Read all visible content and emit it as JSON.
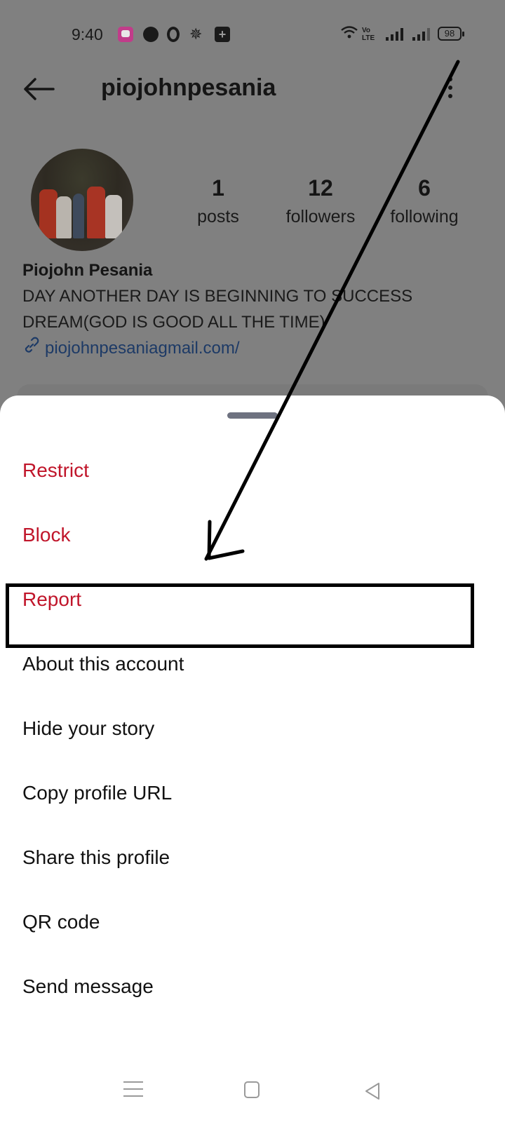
{
  "status_bar": {
    "time": "9:40",
    "notification_icons": [
      "lazada-icon",
      "messenger-icon",
      "opera-icon",
      "pinwheel-app-icon",
      "bible-app-icon"
    ],
    "battery_level": "98"
  },
  "header": {
    "username": "piojohnpesania"
  },
  "profile": {
    "stats": [
      {
        "value": "1",
        "label": "posts"
      },
      {
        "value": "12",
        "label": "followers"
      },
      {
        "value": "6",
        "label": "following"
      }
    ],
    "full_name": "Piojohn Pesania",
    "bio_line1": "DAY ANOTHER DAY IS BEGINNING TO SUCCESS",
    "bio_line2": "DREAM(GOD IS GOOD ALL THE TIME)",
    "link": "piojohnpesaniagmail.com/"
  },
  "sheet": {
    "items": [
      {
        "label": "Restrict",
        "danger": true
      },
      {
        "label": "Block",
        "danger": true
      },
      {
        "label": "Report",
        "danger": true
      },
      {
        "label": "About this account",
        "danger": false
      },
      {
        "label": "Hide your story",
        "danger": false
      },
      {
        "label": "Copy profile URL",
        "danger": false
      },
      {
        "label": "Share this profile",
        "danger": false
      },
      {
        "label": "QR code",
        "danger": false
      },
      {
        "label": "Send message",
        "danger": false
      }
    ]
  },
  "colors": {
    "danger": "#c0152a",
    "link": "#1d3a66",
    "overlay": "#808080",
    "sheet": "#ffffff"
  },
  "annotation": {
    "highlighted_item": "Report"
  }
}
